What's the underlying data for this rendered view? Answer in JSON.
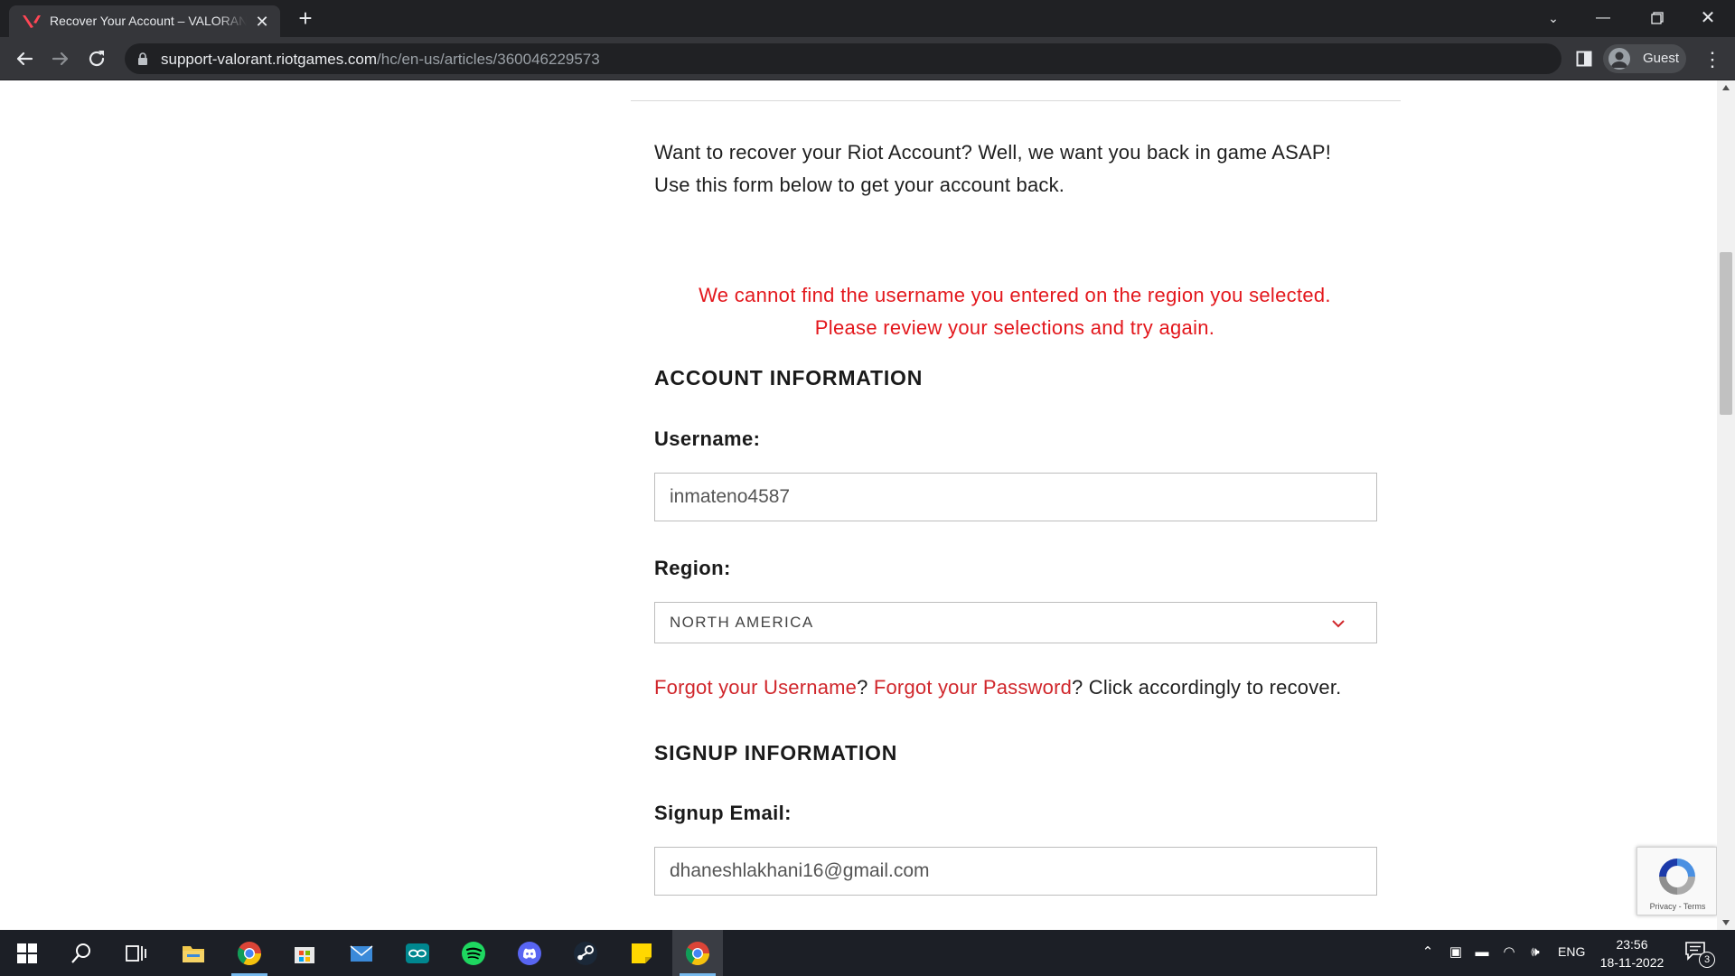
{
  "browser": {
    "tab_title": "Recover Your Account – VALORANT Support",
    "url_host": "support-valorant.riotgames.com",
    "url_path": "/hc/en-us/articles/360046229573",
    "profile_label": "Guest"
  },
  "page": {
    "intro_line1": "Want to recover your Riot Account? Well, we want you back in game ASAP!",
    "intro_line2": "Use this form below to get your account back.",
    "error_line1": "We cannot find the username you entered on the region you selected.",
    "error_line2": "Please review your selections and try again.",
    "account_heading": "ACCOUNT INFORMATION",
    "username_label": "Username:",
    "username_value": "inmateno4587",
    "region_label": "Region:",
    "region_value": "NORTH AMERICA",
    "forgot_username": "Forgot your Username",
    "sep_1": "? ",
    "forgot_password": "Forgot your Password",
    "links_tail": "? Click accordingly to recover.",
    "signup_heading": "SIGNUP INFORMATION",
    "email_label": "Signup Email:",
    "email_value": "dhaneshlakhani16@gmail.com"
  },
  "recaptcha": {
    "terms_text": "Privacy - Terms"
  },
  "taskbar": {
    "apps": [
      "windows-start",
      "search",
      "task-view",
      "file-explorer",
      "chrome",
      "microsoft-store",
      "mail",
      "arduino",
      "spotify",
      "discord",
      "steam",
      "sticky-notes",
      "chrome-active"
    ],
    "language": "ENG",
    "time": "23:56",
    "date": "18-11-2022",
    "notification_count": "3"
  },
  "colors": {
    "accent_red": "#e3171c",
    "link_red": "#d0262b",
    "chrome_dark": "#202124",
    "taskbar_bg": "#1c1f26"
  }
}
